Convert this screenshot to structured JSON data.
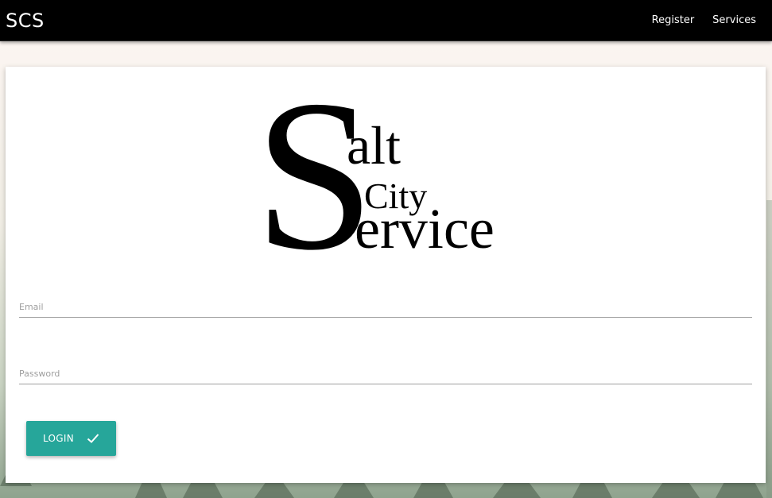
{
  "navbar": {
    "brand": "SCS",
    "links": [
      {
        "label": "Register"
      },
      {
        "label": "Services"
      }
    ]
  },
  "logo": {
    "big_letter": "S",
    "line1": "alt",
    "line2": "City",
    "line3": "ervice"
  },
  "form": {
    "email": {
      "placeholder": "Email",
      "value": ""
    },
    "password": {
      "placeholder": "Password",
      "value": ""
    },
    "login_label": "LOGIN",
    "login_icon": "check-icon"
  },
  "colors": {
    "navbar_bg": "#000000",
    "accent": "#26a69a",
    "card_bg": "#ffffff"
  }
}
